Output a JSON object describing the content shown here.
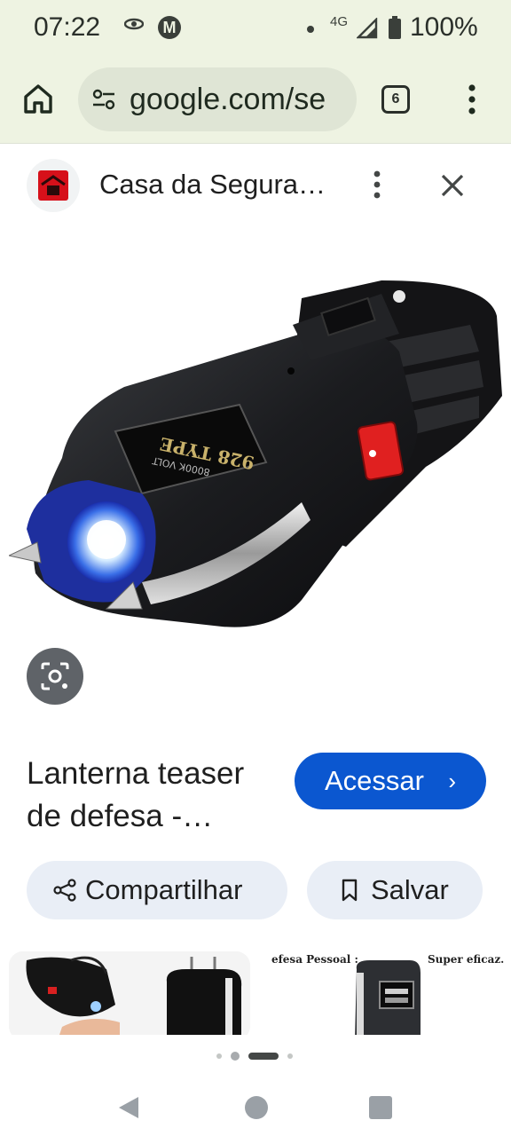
{
  "status_bar": {
    "time": "07:22",
    "network": "4G",
    "battery": "100%",
    "icons": [
      "eye-icon",
      "motorola-icon",
      "signal-icon",
      "battery-icon"
    ]
  },
  "toolbar": {
    "url": "google.com/se",
    "tab_count": "6",
    "icons": [
      "home-icon",
      "site-settings-icon",
      "menu-icon"
    ]
  },
  "sheet": {
    "site_name": "Casa da Segura…",
    "icons": [
      "more-icon",
      "close-icon"
    ]
  },
  "item": {
    "title": "Lanterna teaser de defesa -…",
    "visit_label": "Acessar",
    "share_label": "Compartilhar",
    "save_label": "Salvar",
    "product_label_line1": "928 TYPE",
    "product_label_line2": "8000K VOLT"
  },
  "related": {
    "caption_1": "efesa Pessoal :",
    "caption_2": "Super eficaz."
  },
  "colors": {
    "status_bg": "#eef3e2",
    "accent": "#0b57d0",
    "chip_bg": "#e9eef6"
  }
}
